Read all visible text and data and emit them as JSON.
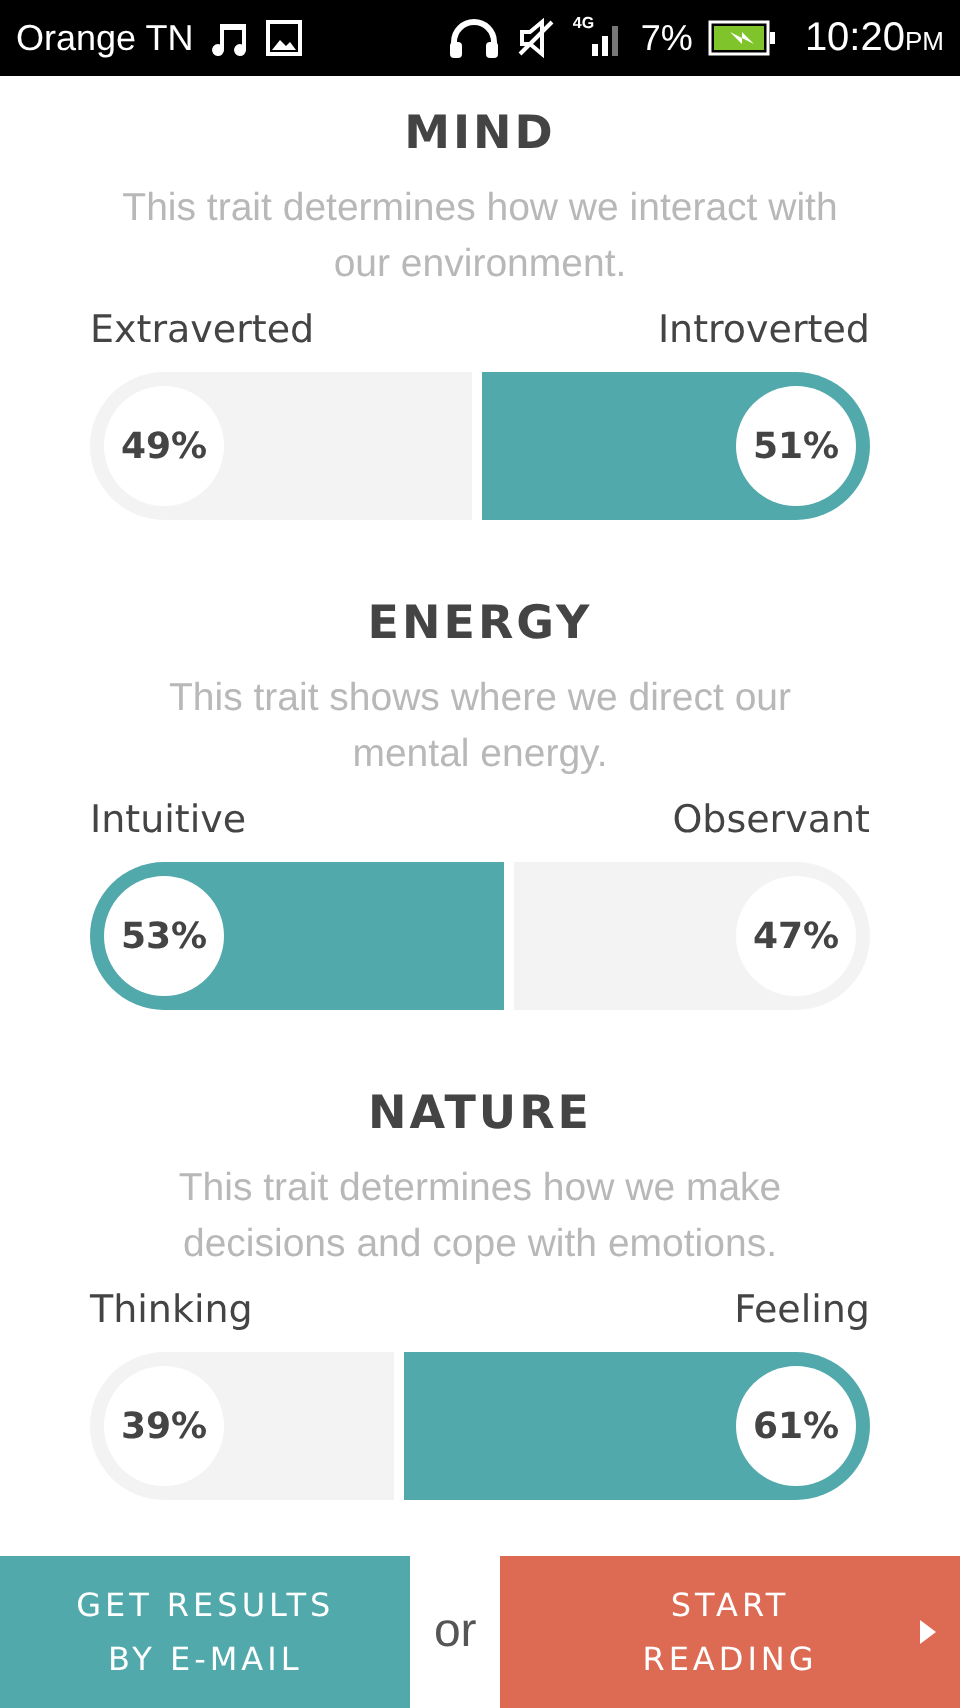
{
  "status_bar": {
    "carrier": "Orange TN",
    "network": "4G",
    "battery": "7%",
    "time": "10:20",
    "period": "PM"
  },
  "traits": [
    {
      "title": "MIND",
      "description": "This trait determines how we interact with our environment.",
      "left": {
        "label": "Extraverted",
        "percent": "49%",
        "selected": false
      },
      "right": {
        "label": "Introverted",
        "percent": "51%",
        "selected": true
      }
    },
    {
      "title": "ENERGY",
      "description": "This trait shows where we direct our mental energy.",
      "left": {
        "label": "Intuitive",
        "percent": "53%",
        "selected": true
      },
      "right": {
        "label": "Observant",
        "percent": "47%",
        "selected": false
      }
    },
    {
      "title": "NATURE",
      "description": "This trait determines how we make decisions and cope with emotions.",
      "left": {
        "label": "Thinking",
        "percent": "39%",
        "selected": false
      },
      "right": {
        "label": "Feeling",
        "percent": "61%",
        "selected": true
      }
    }
  ],
  "footer": {
    "email_button": "GET RESULTS BY E-MAIL",
    "separator": "or",
    "start_button": "START READING"
  }
}
